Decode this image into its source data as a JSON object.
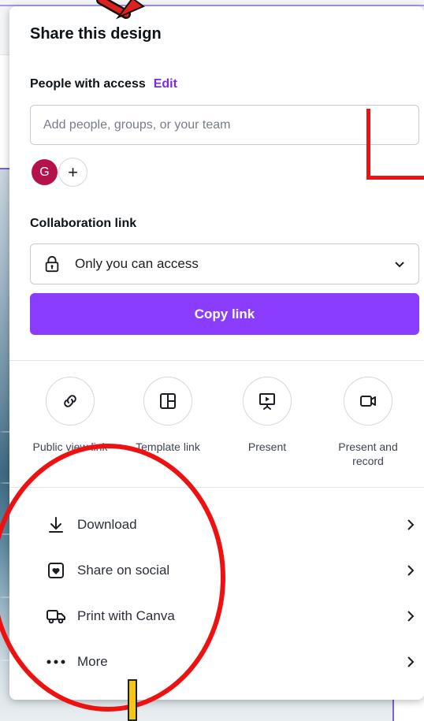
{
  "panel": {
    "title": "Share this design"
  },
  "people": {
    "label": "People with access",
    "edit_label": "Edit",
    "input_placeholder": "Add people, groups, or your team",
    "avatar_initial": "G",
    "add_glyph": "+"
  },
  "collaboration": {
    "label": "Collaboration link",
    "access_value": "Only you can access",
    "copy_label": "Copy link"
  },
  "actions": [
    {
      "label": "Public view link",
      "icon": "link-icon"
    },
    {
      "label": "Template link",
      "icon": "template-icon"
    },
    {
      "label": "Present",
      "icon": "present-icon"
    },
    {
      "label": "Present and record",
      "icon": "record-icon"
    }
  ],
  "rows": [
    {
      "label": "Download",
      "icon": "download-icon"
    },
    {
      "label": "Share on social",
      "icon": "heart-icon"
    },
    {
      "label": "Print with Canva",
      "icon": "truck-icon"
    },
    {
      "label": "More",
      "icon": "more-icon"
    }
  ],
  "colors": {
    "accent": "#8b3dff",
    "edit_link": "#7d2ae8",
    "avatar": "#b5124c",
    "annotation_red": "#ee1111",
    "annotation_yellow": "#f3c718"
  }
}
